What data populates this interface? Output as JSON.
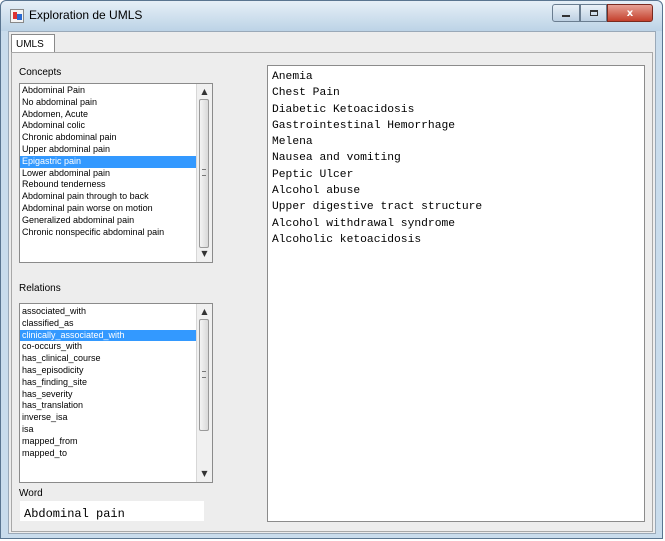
{
  "window": {
    "title": "Exploration de UMLS",
    "close_glyph": "x"
  },
  "tabs": [
    {
      "label": "UMLS"
    }
  ],
  "concepts": {
    "label": "Concepts",
    "items": [
      "Abdominal Pain",
      "No abdominal pain",
      "Abdomen, Acute",
      "Abdominal colic",
      "Chronic abdominal pain",
      "Upper abdominal pain",
      "Epigastric pain",
      "Lower abdominal pain",
      "Rebound tenderness",
      "Abdominal pain through to back",
      "Abdominal pain worse on motion",
      "Generalized abdominal pain",
      "Chronic nonspecific abdominal pain"
    ],
    "selected": "Epigastric pain"
  },
  "relations": {
    "label": "Relations",
    "items": [
      "associated_with",
      "classified_as",
      "clinically_associated_with",
      "co-occurs_with",
      "has_clinical_course",
      "has_episodicity",
      "has_finding_site",
      "has_severity",
      "has_translation",
      "inverse_isa",
      "isa",
      "mapped_from",
      "mapped_to"
    ],
    "selected": "clinically_associated_with"
  },
  "word": {
    "label": "Word",
    "value": "Abdominal pain"
  },
  "results": [
    "Anemia",
    "Chest Pain",
    "Diabetic Ketoacidosis",
    "Gastrointestinal Hemorrhage",
    "Melena",
    "Nausea and vomiting",
    "Peptic Ulcer",
    "Alcohol abuse",
    "Upper digestive tract structure",
    "Alcohol withdrawal syndrome",
    "Alcoholic ketoacidosis"
  ],
  "icons": {
    "app": "java-cup-icon",
    "minimize": "minimize-icon",
    "maximize": "maximize-icon",
    "close": "close-icon",
    "scroll_up": "scroll-up-arrow-icon",
    "scroll_down": "scroll-down-arrow-icon"
  },
  "colors": {
    "selection": "#3399ff",
    "close_button": "#c4402c"
  }
}
